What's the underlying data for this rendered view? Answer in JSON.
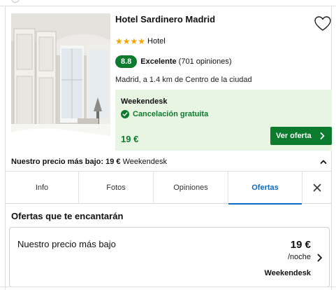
{
  "hotel": {
    "name": "Hotel Sardinero Madrid",
    "stars": 4,
    "stars_display": "★★★★",
    "type_label": "Hotel",
    "score": "8.8",
    "rating_label": "Excelente",
    "reviews": "(701 opiniones)",
    "location": "Madrid, a 1.4 km de Centro de la ciudad"
  },
  "deal": {
    "provider": "Weekendesk",
    "cancellation": "Cancelación gratuita",
    "price": "19 €",
    "cta_label": "Ver oferta"
  },
  "lowest_price": {
    "label": "Nuestro precio más bajo:",
    "price": "19 €",
    "provider": "Weekendesk"
  },
  "tabs": [
    {
      "label": "Info",
      "active": false
    },
    {
      "label": "Fotos",
      "active": false
    },
    {
      "label": "Opiniones",
      "active": false
    },
    {
      "label": "Ofertas",
      "active": true
    }
  ],
  "offers_section": {
    "title": "Ofertas que te encantarán",
    "card": {
      "label": "Nuestro precio más bajo",
      "price": "19 €",
      "unit": "/noche",
      "provider": "Weekendesk"
    }
  },
  "colors": {
    "green": "#0b7b2d",
    "deal_bg": "#e8f5e2",
    "star": "#f5a300",
    "active_tab": "#0a6bc2"
  },
  "icons": [
    "heart-icon",
    "star-icon",
    "check-circle-icon",
    "chevron-right-icon",
    "chevron-up-icon",
    "close-icon"
  ]
}
